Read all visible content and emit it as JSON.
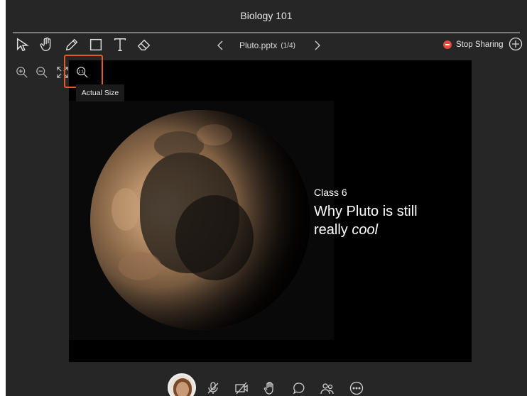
{
  "window": {
    "title": "Biology 101"
  },
  "toolbar": {
    "tools": [
      "select-arrow-icon",
      "pan-hand-icon",
      "pencil-icon",
      "rectangle-icon",
      "text-icon",
      "eraser-icon"
    ],
    "file_name": "Pluto.pptx",
    "page_indicator": "(1/4)",
    "stop_sharing_label": "Stop Sharing"
  },
  "zoom": {
    "buttons": [
      "zoom-in-icon",
      "zoom-out-icon",
      "fit-to-screen-icon",
      "actual-size-icon"
    ],
    "tooltip": "Actual Size"
  },
  "slide": {
    "subtitle": "Class 6",
    "title_line1": "Why Pluto is still",
    "title_line2_prefix": "really ",
    "title_line2_em": "cool"
  },
  "bottom_controls": [
    "avatar",
    "mic-off-icon",
    "camera-off-icon",
    "raise-hand-icon",
    "chat-icon",
    "participants-icon",
    "more-options-icon"
  ],
  "colors": {
    "background": "#262626",
    "accent_highlight": "#e05a2a",
    "stop_red": "#e5483c"
  }
}
